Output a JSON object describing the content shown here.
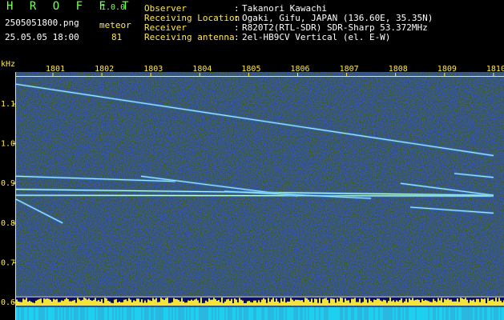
{
  "header": {
    "app_name": "H R O F F T",
    "version": "1.0.0",
    "filename": "2505051800.png",
    "datetime": "25.05.05 18:00",
    "meteor_label": "meteor",
    "meteor_count": "81"
  },
  "info": [
    {
      "label": "Observer",
      "value": "Takanori Kawachi"
    },
    {
      "label": "Receiving Location",
      "value": "Ogaki, Gifu, JAPAN (136.60E, 35.35N)"
    },
    {
      "label": "Receiver",
      "value": "R820T2(RTL-SDR) SDR-Sharp 53.372MHz"
    },
    {
      "label": "Receiving antenna",
      "value": "2el-HB9CV Vertical (el. E-W)"
    }
  ],
  "chart_data": {
    "type": "heatmap",
    "ylabel": "kHz",
    "x_ticks": [
      "1801",
      "1802",
      "1803",
      "1804",
      "1805",
      "1806",
      "1807",
      "1808",
      "1809",
      "1810"
    ],
    "y_ticks": [
      1.1,
      1.0,
      0.9,
      0.8,
      0.7,
      0.6
    ],
    "ylim": [
      0.6,
      1.16
    ],
    "x_range_minutes": [
      0,
      10
    ],
    "traces": [
      {
        "t0": 0.0,
        "f0": 1.15,
        "t1": 10.0,
        "f1": 0.97
      },
      {
        "t0": 0.0,
        "f0": 0.918,
        "t1": 3.5,
        "f1": 0.905
      },
      {
        "t0": 0.0,
        "f0": 0.885,
        "t1": 10.0,
        "f1": 0.87
      },
      {
        "t0": 0.0,
        "f0": 0.87,
        "t1": 10.0,
        "f1": 0.868
      },
      {
        "t0": 0.0,
        "f0": 0.86,
        "t1": 1.2,
        "f1": 0.8
      },
      {
        "t0": 2.8,
        "f0": 0.918,
        "t1": 6.0,
        "f1": 0.868
      },
      {
        "t0": 4.5,
        "f0": 0.88,
        "t1": 7.5,
        "f1": 0.862
      },
      {
        "t0": 8.1,
        "f0": 0.9,
        "t1": 10.0,
        "f1": 0.87
      },
      {
        "t0": 9.2,
        "f0": 0.925,
        "t1": 10.0,
        "f1": 0.915
      },
      {
        "t0": 8.3,
        "f0": 0.84,
        "t1": 10.0,
        "f1": 0.825
      }
    ]
  }
}
